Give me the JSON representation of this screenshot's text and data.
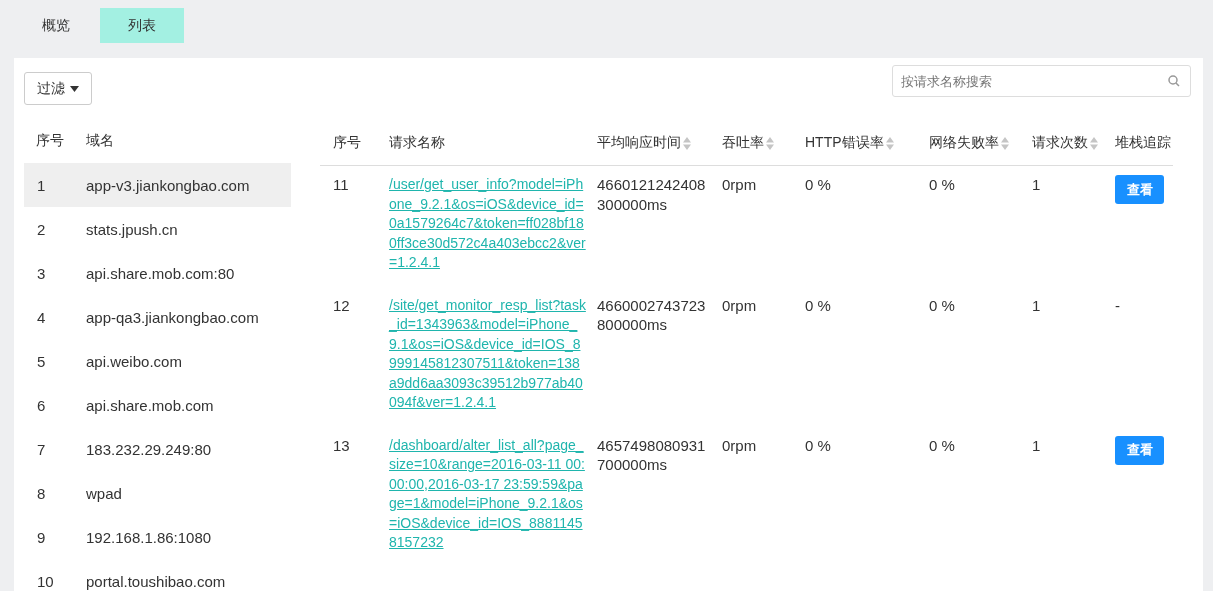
{
  "tabs": [
    {
      "label": "概览",
      "selected": false
    },
    {
      "label": "列表",
      "selected": true
    }
  ],
  "filter_button": {
    "label": "过滤"
  },
  "search": {
    "placeholder": "按请求名称搜索"
  },
  "domain_table": {
    "columns": [
      "序号",
      "域名"
    ],
    "rows": [
      {
        "index": "1",
        "domain": "app-v3.jiankongbao.com",
        "selected": true
      },
      {
        "index": "2",
        "domain": "stats.jpush.cn",
        "selected": false
      },
      {
        "index": "3",
        "domain": "api.share.mob.com:80",
        "selected": false
      },
      {
        "index": "4",
        "domain": "app-qa3.jiankongbao.com",
        "selected": false
      },
      {
        "index": "5",
        "domain": "api.weibo.com",
        "selected": false
      },
      {
        "index": "6",
        "domain": "api.share.mob.com",
        "selected": false
      },
      {
        "index": "7",
        "domain": "183.232.29.249:80",
        "selected": false
      },
      {
        "index": "8",
        "domain": "wpad",
        "selected": false
      },
      {
        "index": "9",
        "domain": "192.168.1.86:1080",
        "selected": false
      },
      {
        "index": "10",
        "domain": "portal.toushibao.com",
        "selected": false
      }
    ]
  },
  "request_table": {
    "columns": [
      {
        "label": "序号",
        "sortable": false
      },
      {
        "label": "请求名称",
        "sortable": false
      },
      {
        "label": "平均响应时间",
        "sortable": true
      },
      {
        "label": "吞吐率",
        "sortable": true
      },
      {
        "label": "HTTP错误率",
        "sortable": true
      },
      {
        "label": "网络失败率",
        "sortable": true
      },
      {
        "label": "请求次数",
        "sortable": true
      },
      {
        "label": "堆栈追踪",
        "sortable": false
      }
    ],
    "rows": [
      {
        "index": "11",
        "name": "/user/get_user_info?model=iPhone_9.2.1&os=iOS&device_id=0a1579264c7&token=ff028bf180ff3ce30d572c4a403ebcc2&ver=1.2.4.1",
        "avg_time": "4660121242408300000ms",
        "throughput": "0rpm",
        "http_error": "0 %",
        "network_fail": "0 %",
        "count": "1",
        "trace": {
          "kind": "button",
          "text": "查看"
        }
      },
      {
        "index": "12",
        "name": "/site/get_monitor_resp_list?task_id=1343963&model=iPhone_9.1&os=iOS&device_id=IOS_8999145812307511&token=138a9dd6aa3093c39512b977ab40094f&ver=1.2.4.1",
        "avg_time": "4660002743723800000ms",
        "throughput": "0rpm",
        "http_error": "0 %",
        "network_fail": "0 %",
        "count": "1",
        "trace": {
          "kind": "text",
          "text": "-"
        }
      },
      {
        "index": "13",
        "name": "/dashboard/alter_list_all?page_size=10&range=2016-03-11 00:00:00,2016-03-17 23:59:59&page=1&model=iPhone_9.2.1&os=iOS&device_id=IOS_88811458157232",
        "avg_time": "4657498080931700000ms",
        "throughput": "0rpm",
        "http_error": "0 %",
        "network_fail": "0 %",
        "count": "1",
        "trace": {
          "kind": "button",
          "text": "查看"
        }
      }
    ]
  }
}
